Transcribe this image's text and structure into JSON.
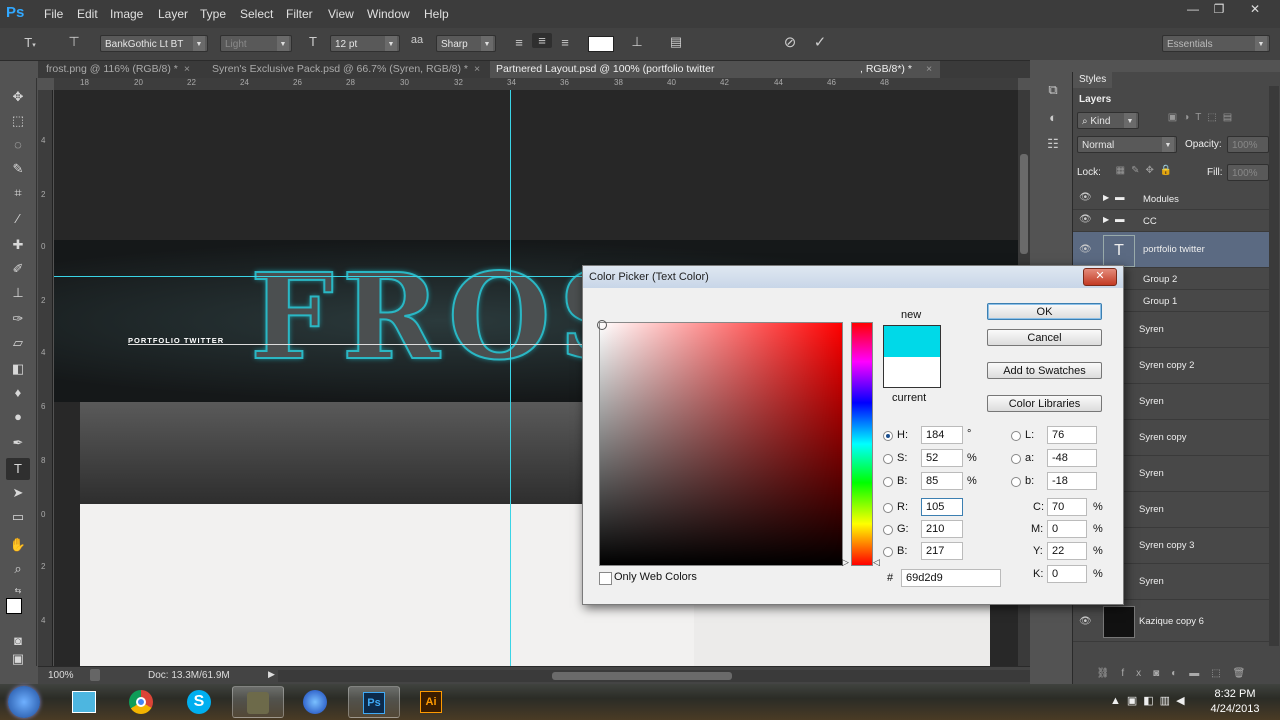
{
  "app": {
    "logo": "Ps"
  },
  "menu": [
    "File",
    "Edit",
    "Image",
    "Layer",
    "Type",
    "Select",
    "Filter",
    "View",
    "Window",
    "Help"
  ],
  "window_controls": {
    "minimize": "—",
    "restore": "❐",
    "close": "✕"
  },
  "options": {
    "font_family": "BankGothic Lt BT",
    "font_style": "Light",
    "font_size": "12 pt",
    "aa_label": "a",
    "antialias": "Sharp",
    "text_color": "#ffffff",
    "workspace": "Essentials"
  },
  "tabs": [
    {
      "label": "frost.png @ 116% (RGB/8) *"
    },
    {
      "label": "Syren's Exclusive Pack.psd @ 66.7% (Syren, RGB/8) *"
    },
    {
      "label": "Partnered Layout.psd @ 100% (portfolio  twitter",
      "label2": ", RGB/8*) *"
    }
  ],
  "ruler_h": [
    "18",
    "20",
    "22",
    "24",
    "26",
    "28",
    "30",
    "32",
    "34",
    "36",
    "38",
    "40",
    "42",
    "44",
    "46",
    "48"
  ],
  "ruler_v": [
    "4",
    "2",
    "0",
    "2",
    "4",
    "6",
    "8",
    "0",
    "2",
    "4"
  ],
  "canvas": {
    "nav_text": "PORTFOLIO   TWITTER",
    "hero_text": "FROSt"
  },
  "status": {
    "zoom": "100%",
    "doc": "Doc: 13.3M/61.9M"
  },
  "panels": {
    "styles_tab": "Styles",
    "layers_tab": "Layers",
    "kind": "Kind",
    "blend": "Normal",
    "opacity_label": "Opacity:",
    "opacity_value": "100%",
    "lock_label": "Lock:",
    "fill_label": "Fill:",
    "fill_value": "100%"
  },
  "layers": [
    {
      "name": "Modules",
      "type": "group"
    },
    {
      "name": "CC",
      "type": "group"
    },
    {
      "name": "portfolio  twitter",
      "type": "text",
      "selected": true
    },
    {
      "name": "Group 2",
      "type": "group"
    },
    {
      "name": "Group 1",
      "type": "group"
    },
    {
      "name": "Syren",
      "type": "pixel"
    },
    {
      "name": "Syren copy 2",
      "type": "pixel"
    },
    {
      "name": "Syren",
      "type": "pixel"
    },
    {
      "name": "Syren copy",
      "type": "pixel"
    },
    {
      "name": "Syren",
      "type": "pixel"
    },
    {
      "name": "Syren",
      "type": "pixel"
    },
    {
      "name": "Syren copy 3",
      "type": "pixel"
    },
    {
      "name": "Syren",
      "type": "pixel"
    },
    {
      "name": "Kazique copy 6",
      "type": "pixel"
    }
  ],
  "color_picker": {
    "title": "Color Picker (Text Color)",
    "new_label": "new",
    "current_label": "current",
    "new_color": "#00d9e8",
    "current_color": "#ffffff",
    "buttons": {
      "ok": "OK",
      "cancel": "Cancel",
      "add_swatches": "Add to Swatches",
      "color_libraries": "Color Libraries"
    },
    "hsb": {
      "H": "184",
      "S": "52",
      "B": "85"
    },
    "hsb_units": {
      "H": "°",
      "S": "%",
      "B": "%"
    },
    "rgb": {
      "R": "105",
      "G": "210",
      "B": "217"
    },
    "lab": {
      "L": "76",
      "a": "-48",
      "b": "-18"
    },
    "cmyk": {
      "C": "70",
      "M": "0",
      "Y": "22",
      "K": "0"
    },
    "hex_label": "#",
    "hex": "69d2d9",
    "only_web_colors": "Only Web Colors",
    "hue_field_color": "#ff0000"
  },
  "taskbar": {
    "apps": [
      "start",
      "notepad",
      "chrome",
      "skype",
      "gimp",
      "ie",
      "photoshop",
      "illustrator"
    ],
    "time": "8:32 PM",
    "date": "4/24/2013"
  }
}
